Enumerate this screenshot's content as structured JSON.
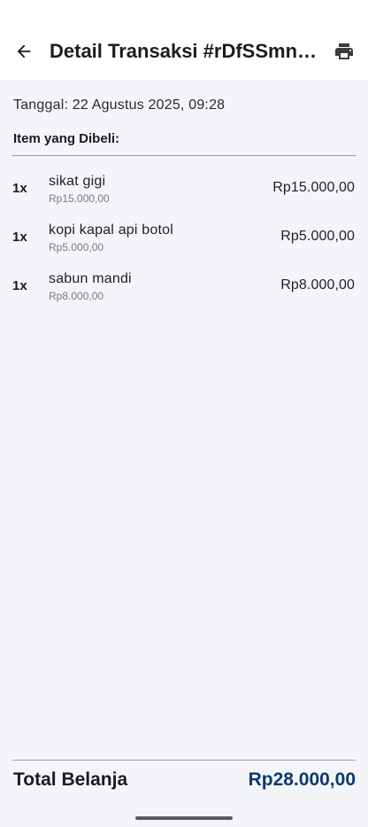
{
  "appbar": {
    "title": "Detail Transaksi #rDfSSmnN...",
    "back_icon": "arrow-left-icon",
    "print_icon": "printer-icon"
  },
  "transaction": {
    "date_text": "Tanggal: 22 Agustus 2025, 09:28",
    "items_heading": "Item yang Dibeli:",
    "items": [
      {
        "qty": "1x",
        "name": "sikat gigi",
        "unit_price": "Rp15.000,00",
        "total": "Rp15.000,00"
      },
      {
        "qty": "1x",
        "name": "kopi kapal api botol",
        "unit_price": "Rp5.000,00",
        "total": "Rp5.000,00"
      },
      {
        "qty": "1x",
        "name": "sabun mandi",
        "unit_price": "Rp8.000,00",
        "total": "Rp8.000,00"
      }
    ],
    "total_label": "Total Belanja",
    "total_value": "Rp28.000,00"
  },
  "colors": {
    "total_accent": "#0d3a6b",
    "background": "#f4f5f8"
  }
}
